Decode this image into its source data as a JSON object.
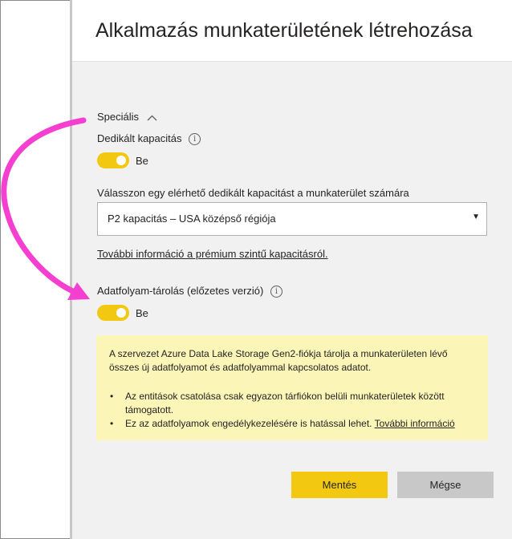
{
  "dialog": {
    "title": "Alkalmazás munkaterületének létrehozása"
  },
  "advanced": {
    "label": "Speciális",
    "expanded": true
  },
  "dedicated_capacity": {
    "label": "Dedikált kapacitás",
    "toggle_on": true,
    "toggle_text": "Be"
  },
  "capacity_select": {
    "label": "Válasszon egy elérhető dedikált kapacitást a munkaterület számára",
    "value": "P2 kapacitás – USA középső régiója"
  },
  "premium_link": {
    "text": "További információ a prémium szintű kapacitásról."
  },
  "dataflow_storage": {
    "label": "Adatfolyam-tárolás (előzetes verzió)",
    "toggle_on": true,
    "toggle_text": "Be"
  },
  "notice": {
    "text": "A szervezet Azure Data Lake Storage Gen2-fiókja tárolja a munkaterületen lévő összes új adatfolyamot és adatfolyammal kapcsolatos adatot.",
    "bullets": [
      "Az entitások csatolása csak egyazon tárfiókon belüli munkaterületek között támogatott.",
      "Ez az adatfolyamok engedélykezelésére is hatással lehet."
    ],
    "more_link": "További információ",
    "background": "#fbf5b8"
  },
  "buttons": {
    "save": "Mentés",
    "cancel": "Mégse"
  },
  "colors": {
    "accent": "#f2c811",
    "annotation_arrow": "#f53fd0"
  }
}
